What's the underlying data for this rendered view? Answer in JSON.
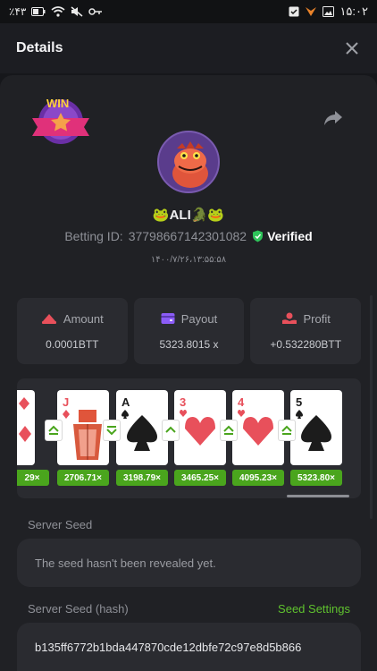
{
  "status_bar": {
    "left_text": "٪۴۳",
    "time": "۱۵:۰۲",
    "icons_left": [
      "battery-icon",
      "wifi-icon",
      "mute-icon",
      "key-icon"
    ],
    "icons_right": [
      "checkbox-icon",
      "fox-app-icon",
      "gallery-icon"
    ]
  },
  "header": {
    "title": "Details",
    "close_icon": "close-icon"
  },
  "profile": {
    "win_badge_text": "WIN",
    "username": "🐸ALI🐊🐸",
    "betting_id_label": "Betting ID:",
    "betting_id": "37798667142301082",
    "verified_label": "Verified",
    "timestamp": "۱۴۰۰/۷/۲۶،۱۳:۵۵:۵۸"
  },
  "stats": [
    {
      "label": "Amount",
      "value": "0.0001BTT",
      "icon": "coins-icon",
      "color": "#e8505b"
    },
    {
      "label": "Payout",
      "value": "5323.8015 x",
      "icon": "wallet-icon",
      "color": "#8b5cf6"
    },
    {
      "label": "Profit",
      "value": "+0.532280BTT",
      "icon": "profit-hand-icon",
      "color": "#e8505b"
    }
  ],
  "cards": [
    {
      "rank": "",
      "suit": "♦",
      "color": "#e8505b"
    },
    {
      "rank": "J",
      "suit": "♦",
      "color": "#e8505b"
    },
    {
      "rank": "A",
      "suit": "♠",
      "color": "#1c1c1c"
    },
    {
      "rank": "3",
      "suit": "♥",
      "color": "#e8505b"
    },
    {
      "rank": "4",
      "suit": "♥",
      "color": "#e8505b"
    },
    {
      "rank": "5",
      "suit": "♠",
      "color": "#1c1c1c"
    }
  ],
  "arrows": [
    "up",
    "down",
    "up",
    "up",
    "up"
  ],
  "multipliers": [
    "29×",
    "2706.71×",
    "3198.79×",
    "3465.25×",
    "4095.23×",
    "5323.80×"
  ],
  "server_seed": {
    "label": "Server Seed",
    "value": "The seed hasn't been revealed yet."
  },
  "server_seed_hash": {
    "label": "Server Seed (hash)",
    "link": "Seed Settings",
    "value": "b135ff6772b1bda447870cde12dbfe72c97e8d5b866"
  },
  "colors": {
    "accent_green": "#5fc22e",
    "multiplier_bg": "#4aa51d",
    "verified_green": "#2ec45a"
  }
}
